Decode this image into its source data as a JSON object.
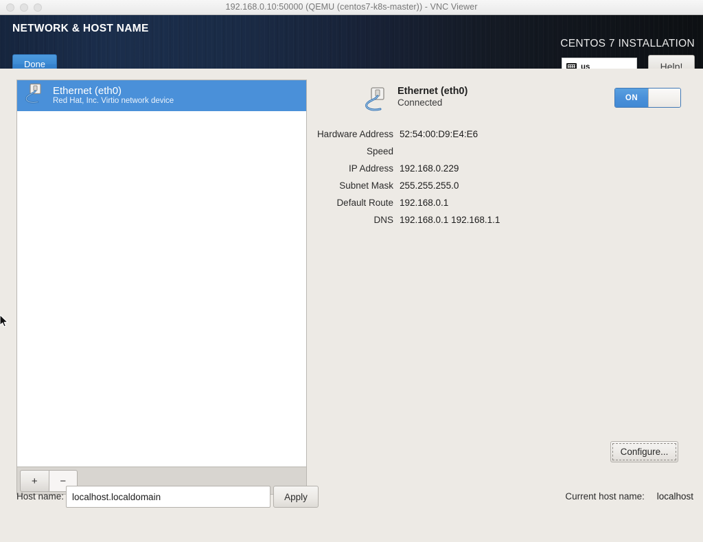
{
  "window": {
    "title": "192.168.0.10:50000 (QEMU (centos7-k8s-master)) - VNC Viewer",
    "buttons": [
      "close",
      "minimize",
      "maximize"
    ]
  },
  "header": {
    "title": "NETWORK & HOST NAME",
    "done_label": "Done",
    "installation_label": "CENTOS 7 INSTALLATION",
    "keyboard_layout": "us",
    "keyboard_icon": "keyboard-icon",
    "help_label": "Help!",
    "bg_left_color": "#16253e",
    "bg_right_color": "#0d1013"
  },
  "device_list": {
    "items": [
      {
        "name": "Ethernet (eth0)",
        "description": "Red Hat, Inc. Virtio network device",
        "icon": "ethernet-cable-icon",
        "selected": true
      }
    ],
    "selection_color": "#4a90d9",
    "toolbar": {
      "add_label": "+",
      "remove_label": "−"
    }
  },
  "detail": {
    "icon": "ethernet-cable-icon",
    "title": "Ethernet (eth0)",
    "status": "Connected",
    "toggle": {
      "state_label": "ON",
      "on": true,
      "accent_color": "#4a90d9"
    },
    "fields": [
      {
        "label": "Hardware Address",
        "value": "52:54:00:D9:E4:E6"
      },
      {
        "label": "Speed",
        "value": ""
      },
      {
        "label": "IP Address",
        "value": "192.168.0.229"
      },
      {
        "label": "Subnet Mask",
        "value": "255.255.255.0"
      },
      {
        "label": "Default Route",
        "value": "192.168.0.1"
      },
      {
        "label": "DNS",
        "value": "192.168.0.1 192.168.1.1"
      }
    ],
    "configure_label": "Configure..."
  },
  "bottom": {
    "hostname_label": "Host name:",
    "hostname_value": "localhost.localdomain",
    "hostname_placeholder": "localhost.localdomain",
    "apply_label": "Apply",
    "current_hostname_label": "Current host name:",
    "current_hostname_value": "localhost"
  }
}
